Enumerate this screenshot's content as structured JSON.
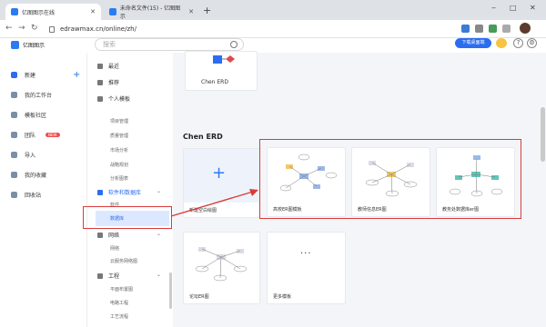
{
  "browser": {
    "tabs": [
      {
        "title": "亿图图示在线",
        "active": true
      },
      {
        "title": "未命名文件(15) - 亿图图示",
        "active": false
      }
    ],
    "new_tab": "+",
    "url": "edrawmax.cn/online/zh/",
    "window_controls": [
      "‒",
      "□",
      "✕"
    ]
  },
  "app": {
    "logo_text": "亿图图示",
    "search_placeholder": "搜索",
    "download_button": "下载桌面端",
    "help_icon": "?",
    "settings_icon": "⚙"
  },
  "sidebar": {
    "items": [
      {
        "label": "新建",
        "icon": "new-file-icon"
      },
      {
        "label": "我的工作台",
        "icon": "workspace-icon"
      },
      {
        "label": "模板社区",
        "icon": "community-icon"
      },
      {
        "label": "团队",
        "icon": "team-icon",
        "badge": "NEW"
      },
      {
        "label": "导入",
        "icon": "import-icon"
      },
      {
        "label": "我的收藏",
        "icon": "favorites-icon"
      },
      {
        "label": "回收站",
        "icon": "trash-icon"
      }
    ],
    "add_label": "+"
  },
  "midnav": {
    "top_items": [
      {
        "label": "最近",
        "icon": "clock-icon"
      },
      {
        "label": "推荐",
        "icon": "recommend-icon"
      },
      {
        "label": "个人模板",
        "icon": "person-icon"
      }
    ],
    "sub_items": [
      "项目管理",
      "质量管理",
      "市场分析",
      "战略规划",
      "分析图表"
    ],
    "category_software": "软件和数据库",
    "software_items": [
      "软件",
      "数据库"
    ],
    "category_network": "网络",
    "network_items": [
      "网络",
      "云服务网络图"
    ],
    "category_engineering": "工程",
    "engineering_items": [
      "平面布置图",
      "电路工程",
      "工艺流程"
    ]
  },
  "main": {
    "top_card_label": "Chen ERD",
    "section_title": "Chen ERD",
    "cards": [
      {
        "label": "新建空白绘图",
        "type": "blank"
      },
      {
        "label": "高校ER图模板",
        "type": "template"
      },
      {
        "label": "教师信息ER图",
        "type": "template"
      },
      {
        "label": "教务处数据库er图",
        "type": "template"
      },
      {
        "label": "论坛ER图",
        "type": "template"
      },
      {
        "label": "更多模板",
        "type": "more"
      }
    ],
    "more_glyph": "···"
  },
  "colors": {
    "accent": "#2b6df0",
    "highlight_red": "#d93b3b",
    "selected_bg": "#dbe8ff"
  }
}
